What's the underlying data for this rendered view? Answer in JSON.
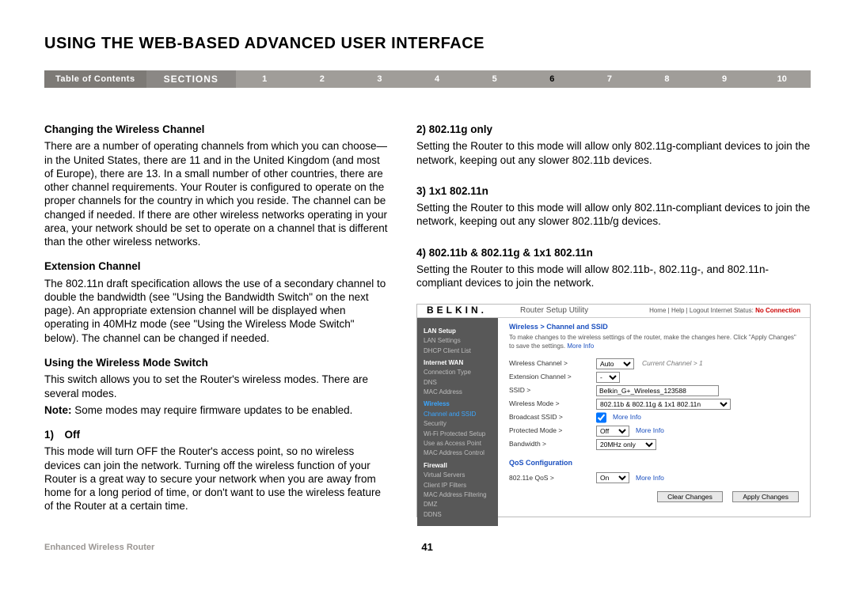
{
  "title": "USING THE WEB-BASED ADVANCED USER INTERFACE",
  "nav": {
    "toc": "Table of Contents",
    "sections": "SECTIONS",
    "nums": [
      "1",
      "2",
      "3",
      "4",
      "5",
      "6",
      "7",
      "8",
      "9",
      "10"
    ],
    "active": "6"
  },
  "left": {
    "h1": "Changing the Wireless Channel",
    "p1": "There are a number of operating channels from which you can choose—in the United States, there are 11 and in the United Kingdom (and most of Europe), there are 13. In a small number of other countries, there are other channel requirements. Your Router is configured to operate on the proper channels for the country in which you reside. The channel can be changed if needed. If there are other wireless networks operating in your area, your network should be set to operate on a channel that is different than the other wireless networks.",
    "h2": "Extension Channel",
    "p2": "The 802.11n draft specification allows the use of a secondary channel to double the bandwidth (see \"Using the Bandwidth Switch\" on the next page). An appropriate extension channel will be displayed when operating in 40MHz mode (see \"Using the Wireless Mode Switch\" below). The channel can be changed if needed.",
    "h3": "Using the Wireless Mode Switch",
    "p3": "This switch allows you to set the Router's wireless modes. There are several modes.",
    "p3b_pre": "Note: ",
    "p3b": "Some modes may require firmware updates to be enabled.",
    "h4": "1) Off",
    "p4": "This mode will turn OFF the Router's access point, so no wireless devices can join the network. Turning off the wireless function of your Router is a great way to secure your network when you are away from home for a long period of time, or don't want to use the wireless feature of the Router at a certain time."
  },
  "right": {
    "h1": "2) 802.11g only",
    "p1": "Setting the Router to this mode will allow only 802.11g-compliant devices to join the network, keeping out any slower 802.11b devices.",
    "h2": "3) 1x1 802.11n",
    "p2": "Setting the Router to this mode will allow only 802.11n-compliant devices to join the network, keeping out any slower 802.11b/g devices.",
    "h3": "4) 802.11b & 802.11g & 1x1 802.11n",
    "p3": "Setting the Router to this mode will allow 802.11b-, 802.11g-, and 802.11n-compliant devices to join the network."
  },
  "router": {
    "logo": "BELKIN.",
    "title": "Router Setup Utility",
    "toplinks": "Home | Help | Logout   Internet Status:",
    "status": "No Connection",
    "side": {
      "g1": "LAN Setup",
      "g1a": "LAN Settings",
      "g1b": "DHCP Client List",
      "g2": "Internet WAN",
      "g2a": "Connection Type",
      "g2b": "DNS",
      "g2c": "MAC Address",
      "g3": "Wireless",
      "g3a": "Channel and SSID",
      "g3b": "Security",
      "g3c": "Wi-Fi Protected Setup",
      "g3d": "Use as Access Point",
      "g3e": "MAC Address Control",
      "g4": "Firewall",
      "g4a": "Virtual Servers",
      "g4b": "Client IP Filters",
      "g4c": "MAC Address Filtering",
      "g4d": "DMZ",
      "g4e": "DDNS"
    },
    "crumb": "Wireless > Channel and SSID",
    "desc1": "To make changes to the wireless settings of the router, make the changes here. Click \"Apply Changes\" to save the settings. ",
    "moreinfo": "More Info",
    "rows": {
      "wc": "Wireless Channel >",
      "wc_val": "Auto",
      "wc_note": "Current Channel > 1",
      "ec": "Extension Channel >",
      "ec_val": "-",
      "ssid": "SSID >",
      "ssid_val": "Belkin_G+_Wireless_123588",
      "wm": "Wireless Mode >",
      "wm_val": "802.11b & 802.11g & 1x1 802.11n",
      "bs": "Broadcast SSID >",
      "pm": "Protected Mode >",
      "pm_val": "Off",
      "bw": "Bandwidth >",
      "bw_val": "20MHz only"
    },
    "qos": "QoS Configuration",
    "qrow": {
      "lab": "802.11e QoS >",
      "val": "On"
    },
    "btn_clear": "Clear Changes",
    "btn_apply": "Apply Changes"
  },
  "footer": {
    "left": "Enhanced Wireless Router",
    "page": "41"
  }
}
